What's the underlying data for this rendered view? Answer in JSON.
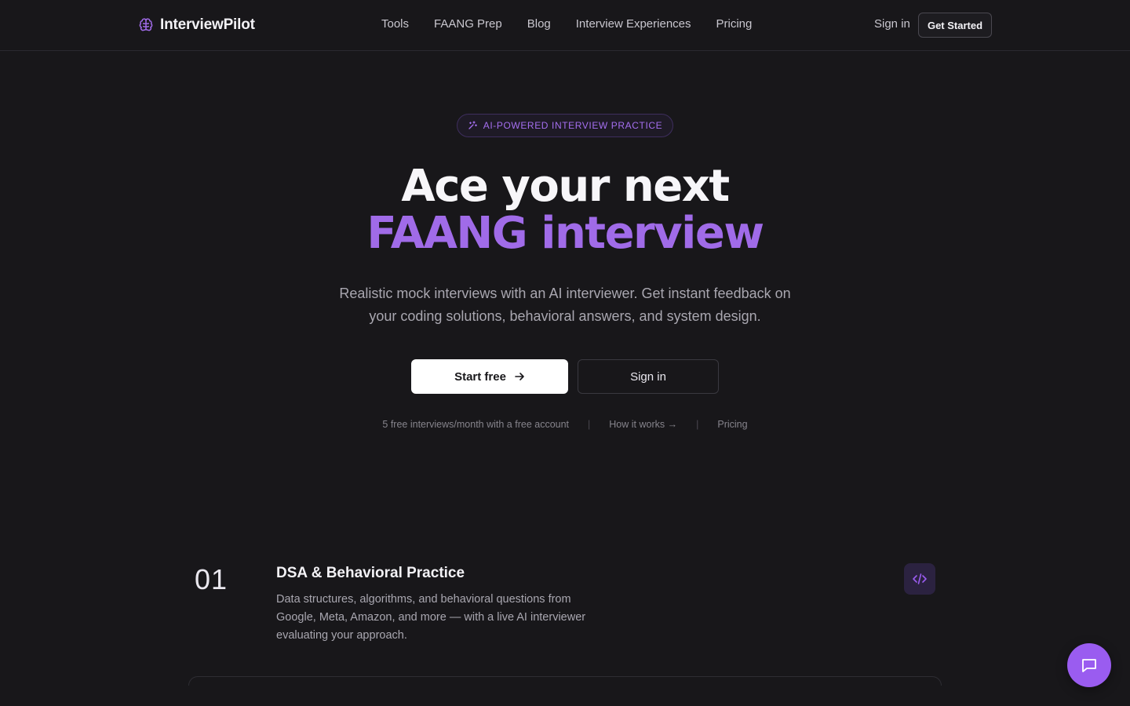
{
  "nav": {
    "brand": "InterviewPilot",
    "links": [
      "Tools",
      "FAANG Prep",
      "Blog",
      "Interview Experiences",
      "Pricing"
    ],
    "sign_in": "Sign in",
    "get_started": "Get Started"
  },
  "hero": {
    "badge": "AI-POWERED INTERVIEW PRACTICE",
    "title_line1": "Ace your next",
    "title_line2": "FAANG interview",
    "subtitle": "Realistic mock interviews with an AI interviewer. Get instant feedback on your coding solutions, behavioral answers, and system design.",
    "primary_cta": "Start free",
    "secondary_cta": "Sign in",
    "meta": {
      "free_note": "5 free interviews/month with a free account",
      "how_it_works": "How it works →",
      "pricing": "Pricing",
      "separator": "|"
    }
  },
  "features": [
    {
      "number": "01",
      "title": "DSA & Behavioral Practice",
      "description": "Data structures, algorithms, and behavioral questions from Google, Meta, Amazon, and more — with a live AI interviewer evaluating your approach.",
      "icon": "code-icon"
    }
  ],
  "colors": {
    "background": "#18171a",
    "accent": "#a06be8",
    "fab": "#9a5cf0"
  }
}
